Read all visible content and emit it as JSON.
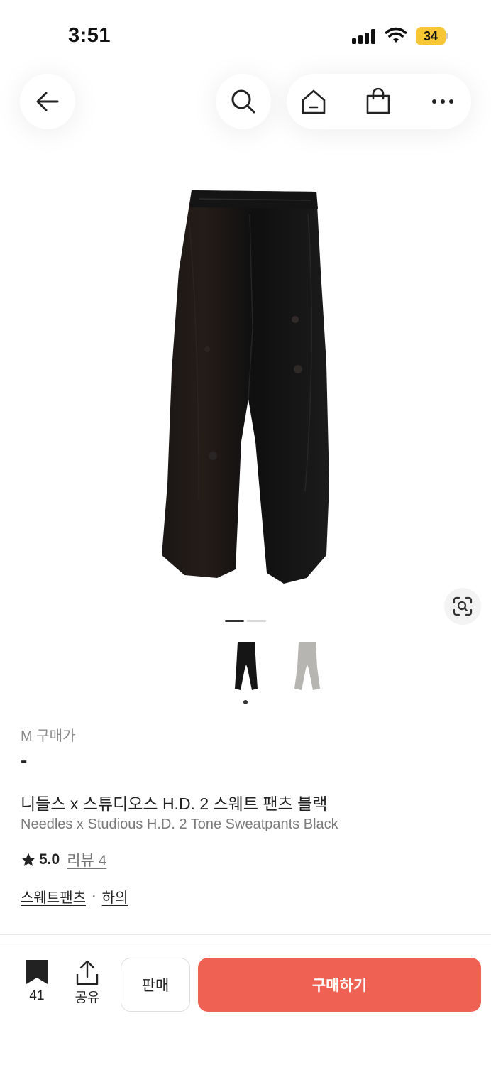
{
  "status_bar": {
    "time": "3:51",
    "battery": "34",
    "battery_color": "#f6c634"
  },
  "nav": {
    "back_icon": "arrow-left-icon",
    "search_icon": "search-icon",
    "home_icon": "home-icon",
    "bag_icon": "shopping-bag-icon",
    "more_icon": "more-horizontal-icon"
  },
  "gallery": {
    "image_count": 2,
    "current_index": 1,
    "thumbnails": [
      {
        "color": "black"
      },
      {
        "color": "gray"
      }
    ],
    "scan_icon": "image-search-icon"
  },
  "product": {
    "price_label": "M 구매가",
    "price_value": "-",
    "title_ko": "니들스 x 스튜디오스 H.D. 2 스웨트 팬츠 블랙",
    "title_en": "Needles x Studious H.D. 2 Tone Sweatpants Black",
    "rating": "5.0",
    "review_link": "리뷰 4",
    "categories": [
      "스웨트팬츠",
      "하의"
    ],
    "category_separator": "·"
  },
  "actions": {
    "bookmark_count": "41",
    "share_label": "공유",
    "sell_label": "판매",
    "buy_label": "구매하기",
    "buy_color": "#ef6253"
  }
}
